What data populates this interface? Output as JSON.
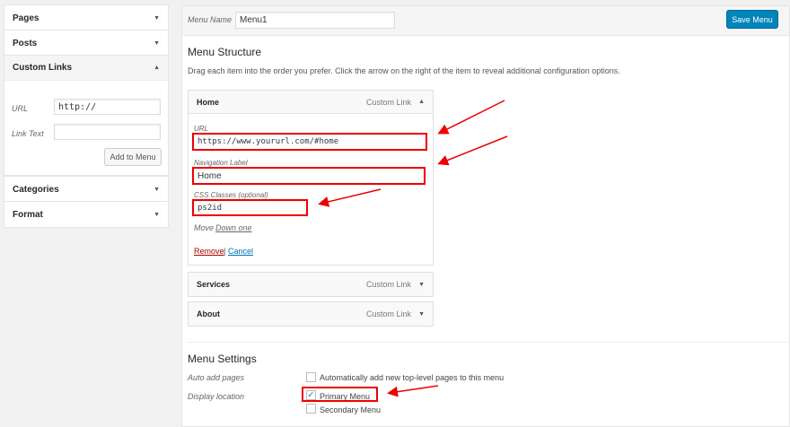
{
  "sidebar": {
    "pages": "Pages",
    "posts": "Posts",
    "custom_links": "Custom Links",
    "url_label": "URL",
    "url_value": "http://",
    "link_text_label": "Link Text",
    "link_text_value": "",
    "add_button": "Add to Menu",
    "categories": "Categories",
    "format": "Format"
  },
  "header": {
    "menu_name_label": "Menu Name",
    "menu_name_value": "Menu1",
    "save_button": "Save Menu"
  },
  "structure": {
    "title": "Menu Structure",
    "description": "Drag each item into the order you prefer. Click the arrow on the right of the item to reveal additional configuration options.",
    "items": [
      {
        "title": "Home",
        "type": "Custom Link"
      },
      {
        "title": "Services",
        "type": "Custom Link"
      },
      {
        "title": "About",
        "type": "Custom Link"
      }
    ],
    "edit": {
      "url_label": "URL",
      "url_value": "https://www.yoururl.com/#home",
      "nav_label": "Navigation Label",
      "nav_value": "Home",
      "css_label": "CSS Classes (optional)",
      "css_value": "ps2id",
      "move_label": "Move",
      "move_link": "Down one",
      "remove": "Remove",
      "sep": "|",
      "cancel": "Cancel"
    }
  },
  "settings": {
    "title": "Menu Settings",
    "auto_add_label": "Auto add pages",
    "auto_add_option": "Automatically add new top-level pages to this menu",
    "display_label": "Display location",
    "primary": "Primary Menu",
    "secondary": "Secondary Menu",
    "primary_checked": true,
    "auto_add_checked": false,
    "secondary_checked": false
  },
  "colors": {
    "accent": "#0085ba",
    "highlight": "#ee0000"
  }
}
